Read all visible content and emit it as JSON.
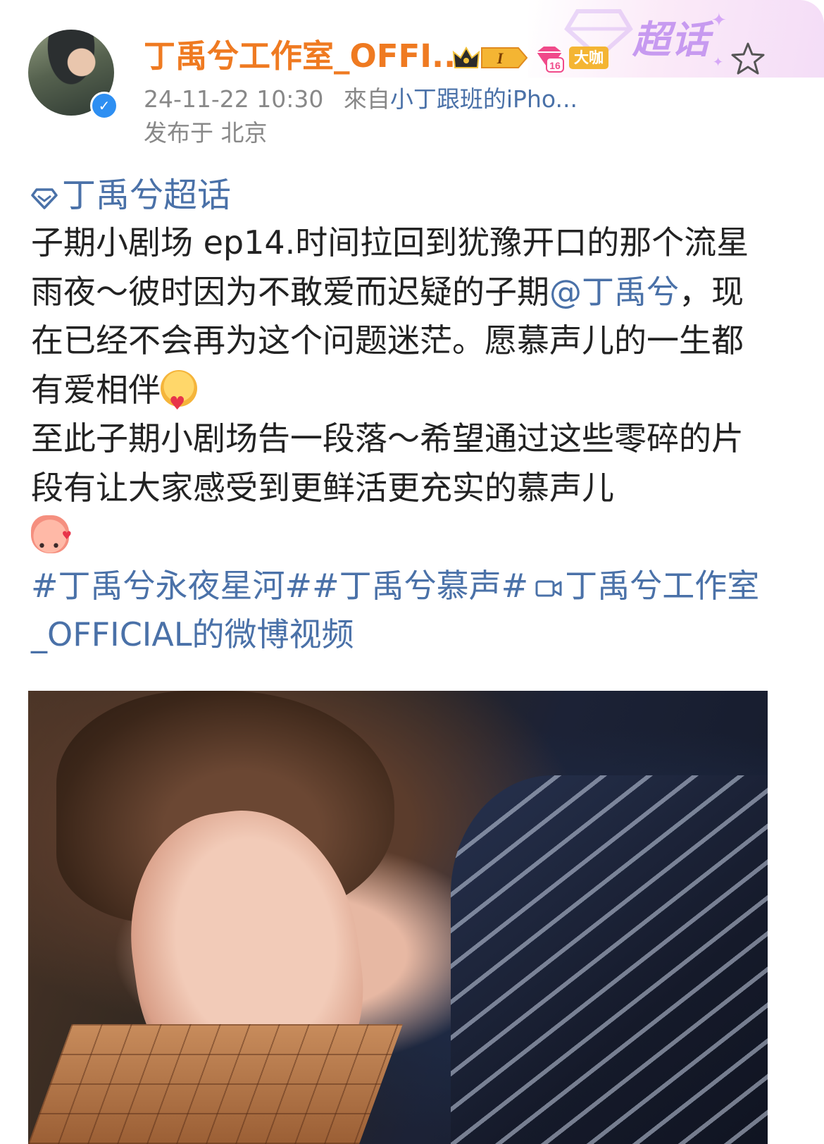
{
  "post": {
    "author": {
      "name": "丁禹兮工作室_OFFI...",
      "badge_label": "大咖",
      "level_label": "16",
      "rank_label": "I"
    },
    "timestamp": "24-11-22 10:30",
    "source_prefix": "來自",
    "source": "小丁跟班的iPho...",
    "location": "发布于 北京",
    "supertopic_badge": "超话",
    "topic": "丁禹兮超话",
    "body": {
      "paragraph1_before_mention": "子期小剧场 ep14.时间拉回到犹豫开口的那个流星雨夜～彼时因为不敢爱而迟疑的子期",
      "mention": "@丁禹兮",
      "paragraph1_after_mention": "，现在已经不会再为这个问题迷茫。愿慕声儿的一生都有爱相伴",
      "paragraph2": "至此子期小剧场告一段落～希望通过这些零碎的片段有让大家感受到更鲜活更充实的慕声儿"
    },
    "hashtags": [
      "#丁禹兮永夜星河#",
      "#丁禹兮慕声#"
    ],
    "video_link": "丁禹兮工作室_OFFICIAL的微博视频"
  },
  "colors": {
    "username": "#ef7a21",
    "link": "#4a71a8",
    "meta": "#888888",
    "body_text": "#222222"
  },
  "icons": [
    "verified-icon",
    "crown-badge-icon",
    "level-badge-icon",
    "star-icon",
    "supertopic-icon",
    "hug-emoji-icon",
    "blob-emoji-icon",
    "video-icon"
  ]
}
